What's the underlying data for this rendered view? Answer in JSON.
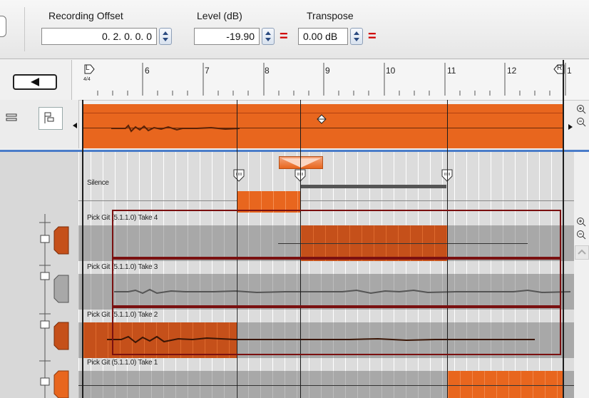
{
  "toolbar": {
    "recording_offset": {
      "label": "Recording Offset",
      "value": "0. 2. 0.   0. 0"
    },
    "level": {
      "label": "Level (dB)",
      "value": "-19.90"
    },
    "transpose": {
      "label": "Transpose",
      "value": "0.00 dB"
    },
    "equal_sign": "="
  },
  "ruler": {
    "left_locator": "L",
    "time_signature": "4/4",
    "right_locator": "R",
    "bars": [
      "6",
      "7",
      "8",
      "9",
      "10",
      "11",
      "12",
      "1"
    ]
  },
  "lanes": {
    "silence_label": "Silence",
    "takes": [
      "Pick Git (5.1.1.0) Take 4",
      "Pick Git (5.1.1.0) Take 3",
      "Pick Git (5.1.1.0) Take 2",
      "Pick Git (5.1.1.0) Take 1"
    ]
  },
  "colors": {
    "accent": "#e8661e",
    "dark_accent": "#c5501a",
    "highlight_border": "#7a1010",
    "selection_line": "#4a7cc9"
  },
  "icons": [
    "back-arrow-icon",
    "list-view-icon",
    "tree-view-icon",
    "zoom-in-icon",
    "zoom-out-icon",
    "spin-icon",
    "marker-icon",
    "fader-icon"
  ]
}
